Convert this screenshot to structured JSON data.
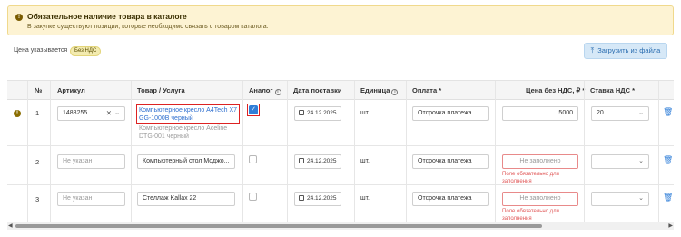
{
  "alert": {
    "icon": "warning-icon",
    "title": "Обязательное наличие товара в каталоге",
    "text": "В закупке существуют позиции, которые необходимо связать с товаром каталога."
  },
  "pricing": {
    "label": "Цена указывается",
    "badge": "Без НДС"
  },
  "upload_button": {
    "icon": "upload-icon",
    "label": "Загрузить из файла"
  },
  "table": {
    "headers": {
      "num": "№",
      "article": "Артикул",
      "product": "Товар / Услуга",
      "analog": "Аналог",
      "delivery_date": "Дата поставки",
      "unit": "Единица",
      "payment": "Оплата *",
      "price": "Цена без НДС, ₽ *",
      "vat": "Ставка НДС *"
    },
    "rows": [
      {
        "num": "1",
        "has_warning": true,
        "article": "1488255",
        "product_link": "Компьютерное кресло A4Tech X7 GG-1000B черный",
        "product_sub": "Компьютерное кресло Aceline DTG-001 черный",
        "analog_checked": true,
        "date": "24.12.2025",
        "unit": "шт.",
        "payment": "Отсрочка платежа",
        "price": "5000",
        "vat": "20"
      },
      {
        "num": "2",
        "has_warning": false,
        "article_placeholder": "Не указан",
        "product": "Компьютерный стол Моджо...",
        "analog_checked": false,
        "date": "24.12.2025",
        "unit": "шт.",
        "payment": "Отсрочка платежа",
        "price_placeholder": "Не заполнено",
        "price_error": "Поле обязательно для заполнения",
        "vat": ""
      },
      {
        "num": "3",
        "has_warning": false,
        "article_placeholder": "Не указан",
        "product": "Стеллаж Kallax 22",
        "analog_checked": false,
        "date": "24.12.2025",
        "unit": "шт.",
        "payment": "Отсрочка платежа",
        "price_placeholder": "Не заполнено",
        "price_error": "Поле обязательно для заполнения",
        "vat": ""
      }
    ]
  },
  "colors": {
    "alert_bg": "#fdf3d3",
    "link": "#2f6fcf",
    "error": "#e05555",
    "highlight": "#dd2222",
    "upload_bg": "#d6e8f7"
  }
}
